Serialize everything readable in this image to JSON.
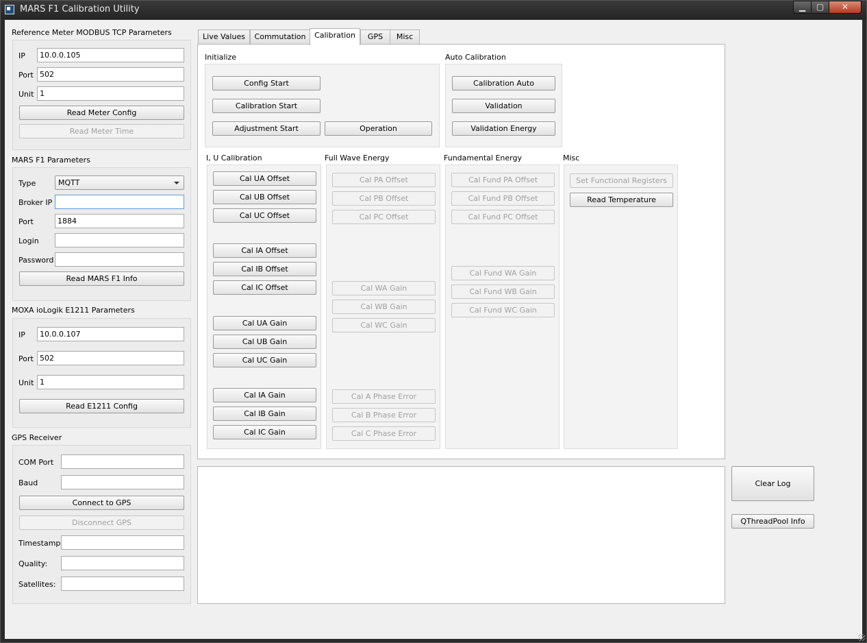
{
  "window": {
    "title": "MARS F1 Calibration Utility",
    "min": "▁",
    "max": "▢",
    "close": "✕"
  },
  "meter": {
    "title": "Reference Meter MODBUS TCP Parameters",
    "ip_label": "IP",
    "ip": "10.0.0.105",
    "port_label": "Port",
    "port": "502",
    "unit_label": "Unit",
    "unit": "1",
    "read_config": "Read Meter Config",
    "read_time": "Read Meter Time"
  },
  "mars": {
    "title": "MARS F1 Parameters",
    "type_label": "Type",
    "type": "MQTT",
    "broker_label": "Broker IP",
    "broker": "",
    "port_label": "Port",
    "port": "1884",
    "login_label": "Login",
    "login": "",
    "password_label": "Password",
    "password": "",
    "read_info": "Read MARS F1 Info"
  },
  "moxa": {
    "title": "MOXA ioLogik E1211 Parameters",
    "ip_label": "IP",
    "ip": "10.0.0.107",
    "port_label": "Port",
    "port": "502",
    "unit_label": "Unit",
    "unit": "1",
    "read_config": "Read E1211 Config"
  },
  "gps": {
    "title": "GPS Receiver",
    "com_label": "COM Port",
    "com": "",
    "baud_label": "Baud",
    "baud": "",
    "connect": "Connect to GPS",
    "disconnect": "Disconnect GPS",
    "timestamp_label": "Timestamp:",
    "timestamp": "",
    "quality_label": "Quality:",
    "quality": "",
    "satellites_label": "Satellites:",
    "satellites": ""
  },
  "tabs": [
    "Live Values",
    "Commutation",
    "Calibration",
    "GPS",
    "Misc"
  ],
  "active_tab": "Calibration",
  "calibration": {
    "initialize": {
      "title": "Initialize",
      "config_start": "Config Start",
      "calibration_start": "Calibration Start",
      "adjustment_start": "Adjustment Start",
      "operation": "Operation"
    },
    "auto": {
      "title": "Auto Calibration",
      "calibration_auto": "Calibration Auto",
      "validation": "Validation",
      "validation_energy": "Validation Energy"
    },
    "iu": {
      "title": "I, U Calibration",
      "buttons": [
        "Cal UA Offset",
        "Cal UB Offset",
        "Cal UC Offset",
        "Cal IA Offset",
        "Cal IB Offset",
        "Cal IC Offset",
        "Cal UA Gain",
        "Cal UB Gain",
        "Cal UC Gain",
        "Cal IA Gain",
        "Cal IB Gain",
        "Cal IC Gain"
      ]
    },
    "full_wave": {
      "title": "Full Wave Energy",
      "buttons": [
        "Cal PA Offset",
        "Cal PB Offset",
        "Cal PC Offset",
        "Cal WA Gain",
        "Cal WB Gain",
        "Cal WC Gain",
        "Cal A Phase Error",
        "Cal B Phase Error",
        "Cal C Phase Error"
      ]
    },
    "fundamental": {
      "title": "Fundamental Energy",
      "buttons": [
        "Cal Fund PA Offset",
        "Cal Fund PB Offset",
        "Cal Fund PC Offset",
        "Cal Fund WA Gain",
        "Cal Fund WB Gain",
        "Cal Fund WC Gain"
      ]
    },
    "misc": {
      "title": "Misc",
      "set_functional": "Set Functional Registers",
      "read_temperature": "Read Temperature"
    }
  },
  "log": {
    "text": ""
  },
  "side": {
    "clear_log": "Clear Log",
    "threadpool": "QThreadPool Info"
  }
}
